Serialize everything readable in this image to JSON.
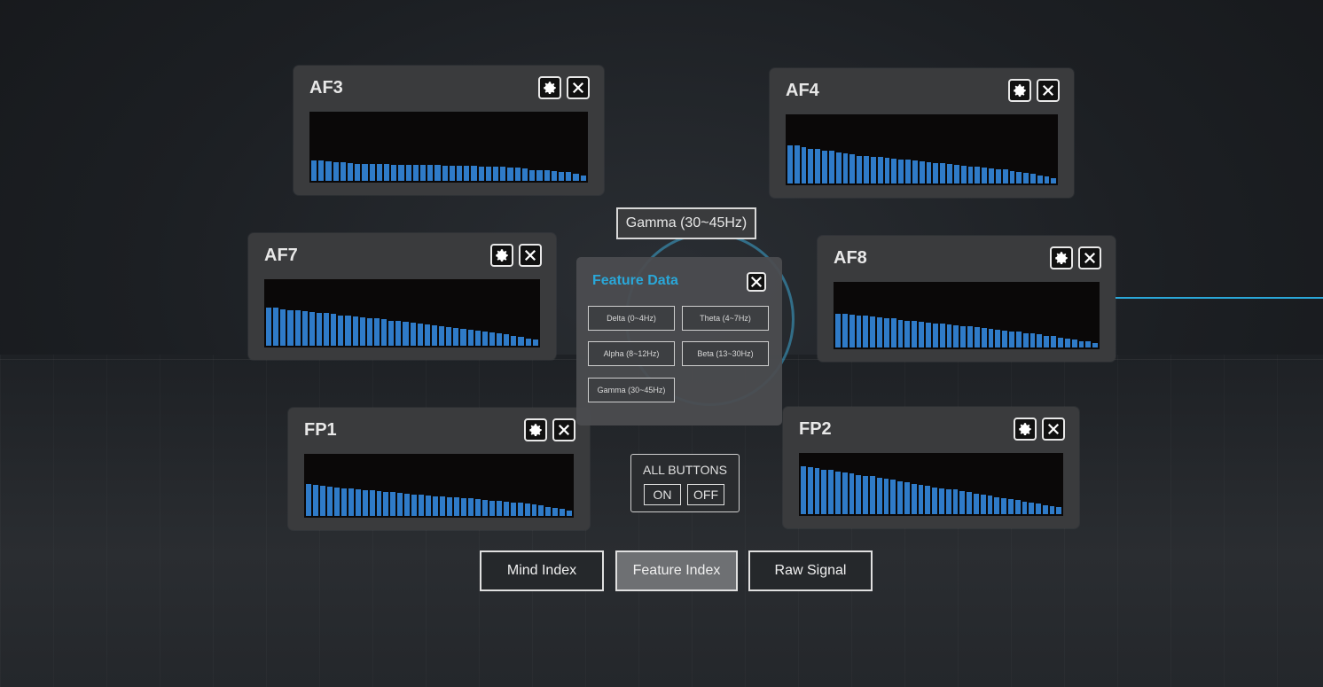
{
  "channels": [
    {
      "id": "af3",
      "label": "AF3",
      "levels": [
        0.3,
        0.3,
        0.28,
        0.27,
        0.27,
        0.26,
        0.25,
        0.25,
        0.24,
        0.24,
        0.24,
        0.23,
        0.23,
        0.23,
        0.23,
        0.23,
        0.23,
        0.23,
        0.22,
        0.22,
        0.22,
        0.22,
        0.22,
        0.21,
        0.2,
        0.2,
        0.2,
        0.19,
        0.19,
        0.18,
        0.16,
        0.15,
        0.15,
        0.14,
        0.13,
        0.13,
        0.1,
        0.08
      ]
    },
    {
      "id": "af4",
      "label": "AF4",
      "levels": [
        0.55,
        0.55,
        0.52,
        0.5,
        0.5,
        0.48,
        0.47,
        0.45,
        0.44,
        0.42,
        0.4,
        0.4,
        0.39,
        0.38,
        0.37,
        0.36,
        0.35,
        0.34,
        0.33,
        0.32,
        0.31,
        0.3,
        0.3,
        0.28,
        0.27,
        0.26,
        0.25,
        0.24,
        0.23,
        0.22,
        0.21,
        0.2,
        0.18,
        0.17,
        0.16,
        0.14,
        0.12,
        0.1,
        0.08
      ]
    },
    {
      "id": "af7",
      "label": "AF7",
      "levels": [
        0.58,
        0.57,
        0.55,
        0.54,
        0.53,
        0.52,
        0.51,
        0.5,
        0.49,
        0.48,
        0.46,
        0.45,
        0.44,
        0.43,
        0.42,
        0.41,
        0.4,
        0.38,
        0.37,
        0.36,
        0.35,
        0.33,
        0.32,
        0.31,
        0.3,
        0.28,
        0.27,
        0.26,
        0.24,
        0.23,
        0.22,
        0.2,
        0.19,
        0.17,
        0.15,
        0.13,
        0.11,
        0.09
      ]
    },
    {
      "id": "af8",
      "label": "AF8",
      "levels": [
        0.52,
        0.52,
        0.5,
        0.49,
        0.48,
        0.47,
        0.46,
        0.45,
        0.44,
        0.42,
        0.41,
        0.4,
        0.39,
        0.38,
        0.37,
        0.36,
        0.35,
        0.34,
        0.33,
        0.32,
        0.31,
        0.3,
        0.28,
        0.27,
        0.26,
        0.25,
        0.24,
        0.22,
        0.21,
        0.2,
        0.18,
        0.17,
        0.15,
        0.14,
        0.12,
        0.1,
        0.09,
        0.07
      ]
    },
    {
      "id": "fp1",
      "label": "FP1",
      "levels": [
        0.52,
        0.5,
        0.48,
        0.47,
        0.46,
        0.45,
        0.44,
        0.43,
        0.42,
        0.41,
        0.4,
        0.39,
        0.38,
        0.37,
        0.36,
        0.35,
        0.34,
        0.33,
        0.32,
        0.31,
        0.3,
        0.3,
        0.29,
        0.28,
        0.27,
        0.26,
        0.25,
        0.24,
        0.23,
        0.22,
        0.21,
        0.2,
        0.18,
        0.17,
        0.15,
        0.13,
        0.11,
        0.09
      ]
    },
    {
      "id": "fp2",
      "label": "FP2",
      "levels": [
        0.78,
        0.77,
        0.75,
        0.73,
        0.72,
        0.7,
        0.68,
        0.66,
        0.64,
        0.63,
        0.62,
        0.6,
        0.58,
        0.56,
        0.54,
        0.52,
        0.5,
        0.48,
        0.46,
        0.44,
        0.42,
        0.41,
        0.4,
        0.38,
        0.36,
        0.34,
        0.32,
        0.3,
        0.28,
        0.26,
        0.25,
        0.23,
        0.21,
        0.19,
        0.17,
        0.15,
        0.13,
        0.11
      ]
    }
  ],
  "icons": {
    "settings": "gear-icon",
    "close": "close-icon"
  },
  "selected_band_tag": "Gamma (30~45Hz)",
  "feature_panel": {
    "title": "Feature Data",
    "bands": [
      "Delta (0~4Hz)",
      "Theta (4~7Hz)",
      "Alpha (8~12Hz)",
      "Beta (13~30Hz)",
      "Gamma (30~45Hz)"
    ]
  },
  "all_buttons": {
    "title": "ALL BUTTONS",
    "on": "ON",
    "off": "OFF"
  },
  "nav": {
    "items": [
      "Mind Index",
      "Feature Index",
      "Raw Signal"
    ],
    "active": "Feature Index"
  },
  "colors": {
    "bar": "#2f7bc8",
    "accent": "#2aa7d8",
    "panel": "#3a3b3d"
  }
}
